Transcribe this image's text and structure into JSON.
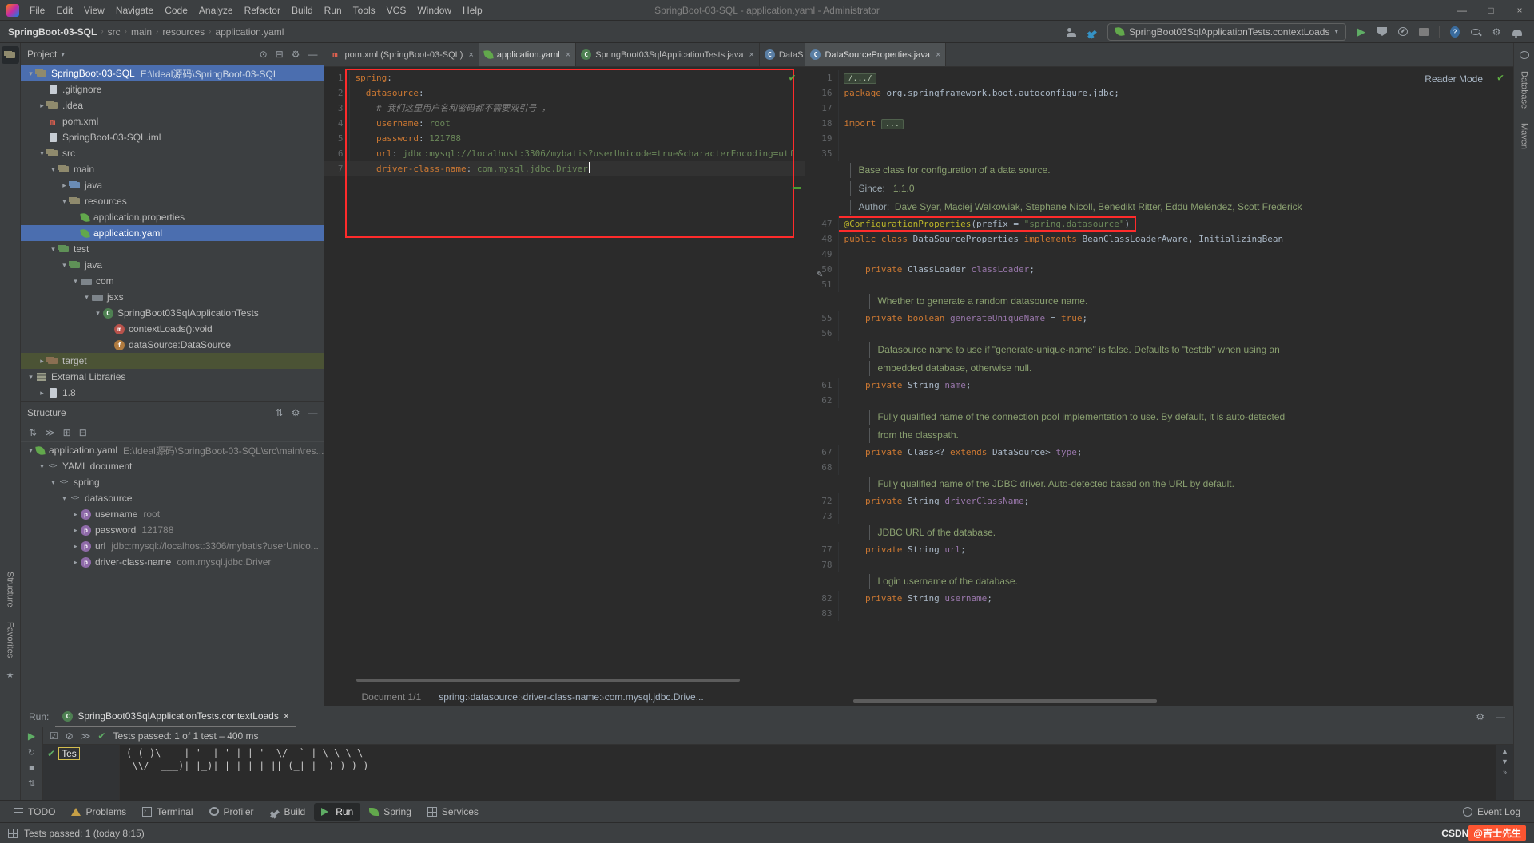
{
  "colors": {
    "selection_blue": "#4b6eaf",
    "annotation_red": "#ff2b2b",
    "test_green": "#5fad65",
    "csdn_red": "#fc5531",
    "yaml_key": "#cc7832",
    "yaml_value": "#6a8759",
    "java_keyword": "#cc7832",
    "java_string": "#6a8759",
    "java_annotation": "#bbb529",
    "java_field": "#9876aa"
  },
  "title_bar": {
    "menus": [
      "File",
      "Edit",
      "View",
      "Navigate",
      "Code",
      "Analyze",
      "Refactor",
      "Build",
      "Run",
      "Tools",
      "VCS",
      "Window",
      "Help"
    ],
    "title": "SpringBoot-03-SQL - application.yaml - Administrator",
    "window_controls": [
      "—",
      "□",
      "×"
    ]
  },
  "navbar": {
    "breadcrumbs": [
      "SpringBoot-03-SQL",
      "src",
      "main",
      "resources",
      "application.yaml"
    ],
    "run_config": "SpringBoot03SqlApplicationTests.contextLoads",
    "icons": [
      "user",
      "build-hammer",
      "run",
      "coverage",
      "profiler",
      "stop",
      "help",
      "search-everywhere",
      "settings",
      "notifications"
    ]
  },
  "left_stripe": {
    "top": [
      "Project"
    ],
    "bottom": [
      "Structure",
      "Favorites"
    ]
  },
  "right_stripe": {
    "top": [
      "Database",
      "Maven"
    ]
  },
  "project_panel": {
    "title": "Project",
    "tree": [
      {
        "indent": 0,
        "chev": "exp",
        "icon": "folder",
        "label": "SpringBoot-03-SQL",
        "extra": "E:\\Ideal源码\\SpringBoot-03-SQL",
        "selected": true
      },
      {
        "indent": 1,
        "chev": "",
        "icon": "file",
        "label": ".gitignore"
      },
      {
        "indent": 1,
        "chev": "col",
        "icon": "folder",
        "label": ".idea"
      },
      {
        "indent": 1,
        "chev": "",
        "icon": "maven",
        "label": "pom.xml"
      },
      {
        "indent": 1,
        "chev": "",
        "icon": "file",
        "label": "SpringBoot-03-SQL.iml"
      },
      {
        "indent": 1,
        "chev": "exp",
        "icon": "folder",
        "label": "src"
      },
      {
        "indent": 2,
        "chev": "exp",
        "icon": "folder",
        "label": "main"
      },
      {
        "indent": 3,
        "chev": "col",
        "icon": "folder-src",
        "label": "java"
      },
      {
        "indent": 3,
        "chev": "exp",
        "icon": "folder",
        "label": "resources"
      },
      {
        "indent": 4,
        "chev": "",
        "icon": "spring",
        "label": "application.properties"
      },
      {
        "indent": 4,
        "chev": "",
        "icon": "spring",
        "label": "application.yaml",
        "selected": true
      },
      {
        "indent": 2,
        "chev": "exp",
        "icon": "folder-test",
        "label": "test"
      },
      {
        "indent": 3,
        "chev": "exp",
        "icon": "folder-test",
        "label": "java"
      },
      {
        "indent": 4,
        "chev": "exp",
        "icon": "pkg",
        "label": "com"
      },
      {
        "indent": 5,
        "chev": "exp",
        "icon": "pkg",
        "label": "jsxs"
      },
      {
        "indent": 6,
        "chev": "exp",
        "icon": "test-class",
        "label": "SpringBoot03SqlApplicationTests"
      },
      {
        "indent": 7,
        "chev": "",
        "icon": "method",
        "label": "contextLoads():void"
      },
      {
        "indent": 7,
        "chev": "",
        "icon": "field",
        "label": "dataSource:DataSource"
      },
      {
        "indent": 1,
        "chev": "col",
        "icon": "folder-excl",
        "label": "target",
        "highlight": true
      },
      {
        "indent": 0,
        "chev": "exp",
        "icon": "lib",
        "label": "External Libraries"
      },
      {
        "indent": 1,
        "chev": "col",
        "icon": "file",
        "label": "1.8"
      }
    ]
  },
  "structure_panel": {
    "title": "Structure",
    "tree": [
      {
        "indent": 0,
        "chev": "exp",
        "icon": "spring",
        "label": "application.yaml",
        "extra": "E:\\Ideal源码\\SpringBoot-03-SQL\\src\\main\\res..."
      },
      {
        "indent": 1,
        "chev": "exp",
        "icon": "tag",
        "label": "YAML document"
      },
      {
        "indent": 2,
        "chev": "exp",
        "icon": "tag",
        "label": "spring"
      },
      {
        "indent": 3,
        "chev": "exp",
        "icon": "tag",
        "label": "datasource"
      },
      {
        "indent": 4,
        "chev": "col",
        "icon": "prop",
        "label": "username",
        "extra": "root"
      },
      {
        "indent": 4,
        "chev": "col",
        "icon": "prop",
        "label": "password",
        "extra": "121788"
      },
      {
        "indent": 4,
        "chev": "col",
        "icon": "prop",
        "label": "url",
        "extra": "jdbc:mysql://localhost:3306/mybatis?userUnico..."
      },
      {
        "indent": 4,
        "chev": "col",
        "icon": "prop",
        "label": "driver-class-name",
        "extra": "com.mysql.jdbc.Driver"
      }
    ]
  },
  "editor": {
    "left_tabs": [
      {
        "icon": "maven",
        "label": "pom.xml (SpringBoot-03-SQL)",
        "close": true
      },
      {
        "icon": "spring",
        "label": "application.yaml",
        "close": true,
        "selected": true
      },
      {
        "icon": "test-class",
        "label": "SpringBoot03SqlApplicationTests.java",
        "close": true
      },
      {
        "icon": "class",
        "label": "DataS",
        "chevron": true
      }
    ],
    "right_tabs": [
      {
        "icon": "class",
        "label": "DataSourceProperties.java",
        "close": true,
        "selected": true
      }
    ],
    "reader_mode_label": "Reader Mode",
    "yaml_lines": [
      {
        "n": "1",
        "toks": [
          [
            "spring",
            "key"
          ],
          [
            ":",
            "plain"
          ]
        ]
      },
      {
        "n": "2",
        "toks": [
          [
            "  ",
            "plain"
          ],
          [
            "datasource",
            "key"
          ],
          [
            ":",
            "plain"
          ]
        ]
      },
      {
        "n": "3",
        "toks": [
          [
            "    ",
            "plain"
          ],
          [
            "# 我们这里用户名和密码都不需要双引号 ，",
            "com"
          ]
        ]
      },
      {
        "n": "4",
        "toks": [
          [
            "    ",
            "plain"
          ],
          [
            "username",
            "key"
          ],
          [
            ": ",
            "plain"
          ],
          [
            "root",
            "val"
          ]
        ]
      },
      {
        "n": "5",
        "toks": [
          [
            "    ",
            "plain"
          ],
          [
            "password",
            "key"
          ],
          [
            ": ",
            "plain"
          ],
          [
            "121788",
            "val"
          ]
        ]
      },
      {
        "n": "6",
        "toks": [
          [
            "    ",
            "plain"
          ],
          [
            "url",
            "key"
          ],
          [
            ": ",
            "plain"
          ],
          [
            "jdbc:mysql://localhost:3306/mybatis?userUnicode=true&characterEncoding=utf",
            "val"
          ]
        ]
      },
      {
        "n": "7",
        "current": true,
        "cursor": true,
        "toks": [
          [
            "    ",
            "plain"
          ],
          [
            "driver-class-name",
            "key"
          ],
          [
            ": ",
            "plain"
          ],
          [
            "com.mysql.jdbc.Driver",
            "val"
          ]
        ]
      }
    ],
    "java_rows": [
      {
        "n": "1",
        "toks": [
          [
            "/.../",
            "folded"
          ]
        ]
      },
      {
        "n": "16",
        "toks": [
          [
            "package ",
            "kw"
          ],
          [
            "org.springframework.boot.autoconfigure.jdbc;",
            "plain"
          ]
        ]
      },
      {
        "n": "17",
        "toks": []
      },
      {
        "n": "18",
        "toks": [
          [
            "import ",
            "kw"
          ],
          [
            "...",
            "folded"
          ]
        ]
      },
      {
        "n": "19",
        "toks": []
      },
      {
        "n": "35",
        "toks": []
      },
      {
        "doc": 1,
        "ind": 0,
        "toks": [
          [
            "Base class for configuration of a data source.",
            "doc"
          ]
        ]
      },
      {
        "doc": 1,
        "ind": 0,
        "toks": [
          [
            "Since:",
            "doclabel"
          ],
          [
            "   1.1.0",
            "doc"
          ]
        ]
      },
      {
        "doc": 1,
        "ind": 0,
        "toks": [
          [
            "Author:",
            "doclabel"
          ],
          [
            "  Dave Syer, Maciej Walkowiak, Stephane Nicoll, Benedikt Ritter, Eddú Meléndez, Scott Frederick",
            "doc"
          ]
        ]
      },
      {
        "n": "47",
        "redbox": true,
        "toks": [
          [
            "@ConfigurationProperties",
            "ann"
          ],
          [
            "(prefix = ",
            "plain"
          ],
          [
            "\"spring.datasource\"",
            "str"
          ],
          [
            ")",
            "plain"
          ]
        ]
      },
      {
        "n": "48",
        "toks": [
          [
            "public class ",
            "kw"
          ],
          [
            "DataSourceProperties ",
            "plain"
          ],
          [
            "implements ",
            "kw"
          ],
          [
            "BeanClassLoaderAware, InitializingBean",
            "plain"
          ]
        ]
      },
      {
        "n": "49",
        "toks": []
      },
      {
        "n": "50",
        "toks": [
          [
            "    private ",
            "kw"
          ],
          [
            "ClassLoader ",
            "plain"
          ],
          [
            "classLoader",
            "field"
          ],
          [
            ";",
            "plain"
          ]
        ]
      },
      {
        "n": "51",
        "toks": []
      },
      {
        "doc": 1,
        "ind": 1,
        "toks": [
          [
            "Whether to generate a random datasource name.",
            "doc"
          ]
        ]
      },
      {
        "n": "55",
        "toks": [
          [
            "    private boolean ",
            "kw"
          ],
          [
            "generateUniqueName ",
            "field"
          ],
          [
            "= ",
            "plain"
          ],
          [
            "true",
            "kw"
          ],
          [
            ";",
            "plain"
          ]
        ]
      },
      {
        "n": "56",
        "toks": []
      },
      {
        "doc": 1,
        "ind": 1,
        "toks": [
          [
            "Datasource name to use if \"generate-unique-name\" is false. Defaults to \"testdb\" when using an",
            "doc"
          ]
        ]
      },
      {
        "doc": 1,
        "ind": 1,
        "toks": [
          [
            "embedded database, otherwise null.",
            "doc"
          ]
        ]
      },
      {
        "n": "61",
        "toks": [
          [
            "    private ",
            "kw"
          ],
          [
            "String ",
            "plain"
          ],
          [
            "name",
            "field"
          ],
          [
            ";",
            "plain"
          ]
        ]
      },
      {
        "n": "62",
        "toks": []
      },
      {
        "doc": 1,
        "ind": 1,
        "toks": [
          [
            "Fully qualified name of the connection pool implementation to use. By default, it is auto-detected",
            "doc"
          ]
        ]
      },
      {
        "doc": 1,
        "ind": 1,
        "toks": [
          [
            "from the classpath.",
            "doc"
          ]
        ]
      },
      {
        "n": "67",
        "toks": [
          [
            "    private ",
            "kw"
          ],
          [
            "Class<? ",
            "plain"
          ],
          [
            "extends ",
            "kw"
          ],
          [
            "DataSource> ",
            "plain"
          ],
          [
            "type",
            "field"
          ],
          [
            ";",
            "plain"
          ]
        ]
      },
      {
        "n": "68",
        "toks": []
      },
      {
        "doc": 1,
        "ind": 1,
        "toks": [
          [
            "Fully qualified name of the JDBC driver. Auto-detected based on the URL by default.",
            "doc"
          ]
        ]
      },
      {
        "n": "72",
        "toks": [
          [
            "    private ",
            "kw"
          ],
          [
            "String ",
            "plain"
          ],
          [
            "driverClassName",
            "field"
          ],
          [
            ";",
            "plain"
          ]
        ]
      },
      {
        "n": "73",
        "toks": []
      },
      {
        "doc": 1,
        "ind": 1,
        "toks": [
          [
            "JDBC URL of the database.",
            "doc"
          ]
        ]
      },
      {
        "n": "77",
        "toks": [
          [
            "    private ",
            "kw"
          ],
          [
            "String ",
            "plain"
          ],
          [
            "url",
            "field"
          ],
          [
            ";",
            "plain"
          ]
        ]
      },
      {
        "n": "78",
        "toks": []
      },
      {
        "doc": 1,
        "ind": 1,
        "toks": [
          [
            "Login username of the database.",
            "doc"
          ]
        ]
      },
      {
        "n": "82",
        "toks": [
          [
            "    private ",
            "kw"
          ],
          [
            "String ",
            "plain"
          ],
          [
            "username",
            "field"
          ],
          [
            ";",
            "plain"
          ]
        ]
      },
      {
        "n": "83",
        "toks": []
      }
    ],
    "footer": {
      "document_label": "Document 1/1",
      "path": [
        "spring:",
        "datasource:",
        "driver-class-name:",
        "com.mysql.jdbc.Drive..."
      ]
    }
  },
  "run_panel": {
    "label": "Run:",
    "tab": {
      "label": "SpringBoot03SqlApplicationTests.contextLoads"
    },
    "status": "Tests passed: 1 of 1 test – 400 ms",
    "test_tree_item": "Tes",
    "console_lines": [
      "( ( )\\___ | '_ | '_| | '_ \\/ _` | \\ \\ \\ \\",
      " \\\\/  ___)| |_)| | | | | || (_| |  ) ) ) )"
    ]
  },
  "bottom_bar": {
    "left": [
      {
        "icon": "todo",
        "label": "TODO"
      },
      {
        "icon": "problems",
        "label": "Problems"
      },
      {
        "icon": "terminal",
        "label": "Terminal"
      },
      {
        "icon": "profiler",
        "label": "Profiler"
      },
      {
        "icon": "build",
        "label": "Build"
      },
      {
        "icon": "run",
        "label": "Run",
        "active": true
      },
      {
        "icon": "spring",
        "label": "Spring"
      },
      {
        "icon": "services",
        "label": "Services"
      }
    ],
    "right": [
      {
        "icon": "eventlog",
        "label": "Event Log"
      }
    ]
  },
  "status_bar": {
    "left": "Tests passed: 1 (today 8:15)",
    "watermark_prefix": "CSDN ",
    "watermark_name": "@吉士先生"
  }
}
